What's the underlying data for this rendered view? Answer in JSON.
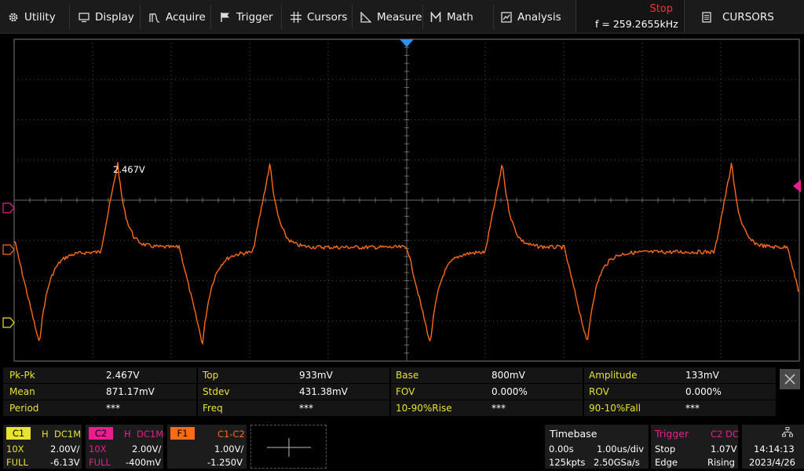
{
  "menu": {
    "items": [
      {
        "key": "utility",
        "label": "Utility",
        "icon": "gear-icon"
      },
      {
        "key": "display",
        "label": "Display",
        "icon": "monitor-icon"
      },
      {
        "key": "acquire",
        "label": "Acquire",
        "icon": "acquire-icon"
      },
      {
        "key": "trigger",
        "label": "Trigger",
        "icon": "trigger-flag-icon"
      },
      {
        "key": "cursors",
        "label": "Cursors",
        "icon": "crosshair-icon"
      },
      {
        "key": "measure",
        "label": "Measure",
        "icon": "ruler-icon"
      },
      {
        "key": "math",
        "label": "Math",
        "icon": "math-m-icon"
      },
      {
        "key": "analysis",
        "label": "Analysis",
        "icon": "analysis-chart-icon"
      }
    ],
    "run_state": "Stop",
    "frequency": "f = 259.2655kHz",
    "cursors_label": "CURSORS"
  },
  "colors": {
    "ch1": "#e8e233",
    "ch2": "#ea1f8f",
    "f1": "#ff6a14",
    "trace": "#ff6a14",
    "stop": "#ff2e2e",
    "grid": "#4c4c4c",
    "trigger_marker": "#2f8ff2"
  },
  "measurements": [
    [
      {
        "label": "Pk-Pk",
        "value": "2.467V"
      },
      {
        "label": "Top",
        "value": "933mV"
      },
      {
        "label": "Base",
        "value": "800mV"
      },
      {
        "label": "Amplitude",
        "value": "133mV"
      }
    ],
    [
      {
        "label": "Mean",
        "value": "871.17mV"
      },
      {
        "label": "Stdev",
        "value": "431.38mV"
      },
      {
        "label": "FOV",
        "value": "0.000%"
      },
      {
        "label": "ROV",
        "value": "0.000%"
      }
    ],
    [
      {
        "label": "Period",
        "value": "***"
      },
      {
        "label": "Freq",
        "value": "***"
      },
      {
        "label": "10-90%Rise",
        "value": "***"
      },
      {
        "label": "90-10%Fall",
        "value": "***"
      }
    ]
  ],
  "waveform_annotation": "2.467V",
  "channels": {
    "c1": {
      "tag": "C1",
      "bw": "H",
      "coupling": "DC1M",
      "probe": "10X",
      "scale": "2.00V/",
      "bandwidth": "FULL",
      "offset": "-6.13V"
    },
    "c2": {
      "tag": "C2",
      "bw": "H",
      "coupling": "DC1M",
      "probe": "10X",
      "scale": "2.00V/",
      "bandwidth": "FULL",
      "offset": "-400mV"
    },
    "f1": {
      "tag": "F1",
      "source": "C1-C2",
      "scale": "1.00V/",
      "offset": "-1.250V"
    }
  },
  "timebase": {
    "title": "Timebase",
    "delay": "0.00s",
    "scale": "1.00us/div",
    "points": "125kpts",
    "rate": "2.50GSa/s"
  },
  "trigger": {
    "title": "Trigger",
    "source": "C2 DC",
    "mode": "Stop",
    "level": "1.07V",
    "type": "Edge",
    "slope": "Rising"
  },
  "clock": {
    "time": "14:14:13",
    "date": "2023/4/26"
  }
}
